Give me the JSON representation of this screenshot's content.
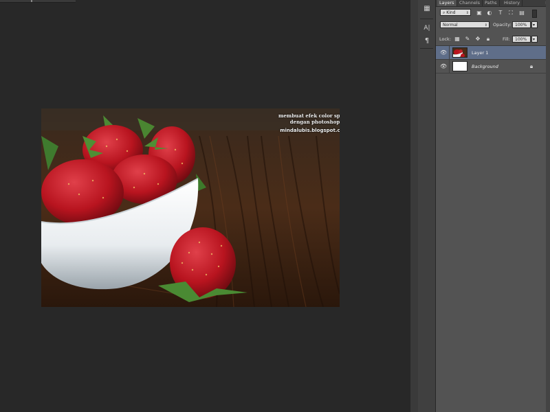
{
  "panel": {
    "tabs": [
      {
        "label": "Layers",
        "active": true
      },
      {
        "label": "Channels",
        "active": false
      },
      {
        "label": "Paths",
        "active": false
      },
      {
        "label": "History",
        "active": false
      }
    ],
    "filter_kind": "Kind",
    "blend_mode": "Normal",
    "opacity_label": "Opacity:",
    "opacity_value": "100%",
    "lock_label": "Lock:",
    "fill_label": "Fill:",
    "fill_value": "100%",
    "layers": [
      {
        "name": "Layer 1",
        "selected": true,
        "locked": false
      },
      {
        "name": "Background",
        "selected": false,
        "locked": true
      }
    ]
  },
  "document": {
    "watermark_line1": "membuat efek color splash",
    "watermark_line2": "dengan photoshop",
    "watermark_site": "mindalubis.blogspot.com"
  },
  "colors": {
    "canvas_bg": "#282828",
    "panel_bg": "#535353",
    "selected_layer": "#5f6e89"
  }
}
